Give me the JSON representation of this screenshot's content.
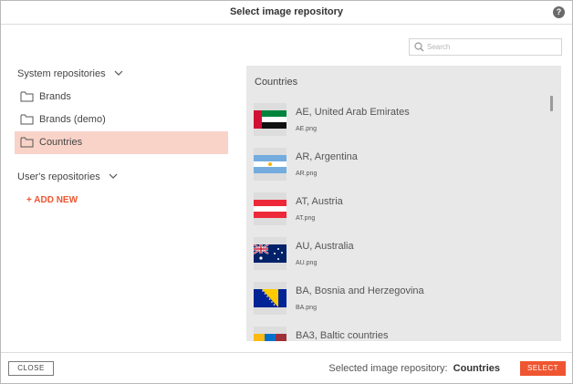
{
  "dialog": {
    "title": "Select image repository",
    "help": "?"
  },
  "search": {
    "placeholder": "Search",
    "value": ""
  },
  "system_repos": {
    "heading": "System repositories",
    "items": [
      {
        "label": "Brands",
        "selected": false
      },
      {
        "label": "Brands (demo)",
        "selected": false
      },
      {
        "label": "Countries",
        "selected": true
      }
    ]
  },
  "user_repos": {
    "heading": "User's repositories",
    "add_label": "+ ADD NEW"
  },
  "panel": {
    "title": "Countries",
    "items": [
      {
        "name": "AE, United Arab Emirates",
        "file": "AE.png",
        "flag": "ae-flag"
      },
      {
        "name": "AR, Argentina",
        "file": "AR.png",
        "flag": "ar-flag"
      },
      {
        "name": "AT, Austria",
        "file": "AT.png",
        "flag": "at-flag"
      },
      {
        "name": "AU, Australia",
        "file": "AU.png",
        "flag": "au-flag"
      },
      {
        "name": "BA, Bosnia and Herzegovina",
        "file": "BA.png",
        "flag": "ba-flag"
      },
      {
        "name": "BA3, Baltic countries",
        "file": "",
        "flag": "baltic-flag"
      }
    ]
  },
  "footer": {
    "close_label": "CLOSE",
    "selected_prefix": "Selected image repository:",
    "selected_value": "Countries",
    "select_label": "SELECT"
  },
  "colors": {
    "accent": "#ef5530",
    "selected_bg": "#f9d3c8",
    "panel_bg": "#e8e8e8"
  }
}
